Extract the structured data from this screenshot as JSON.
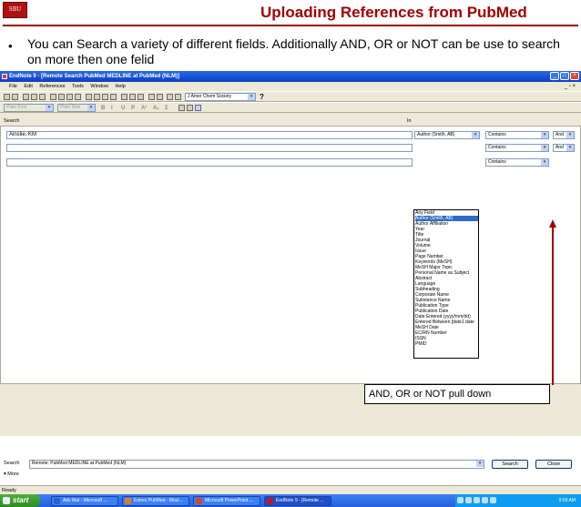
{
  "slide": {
    "logo_text": "SBU",
    "title": "Uploading References from PubMed",
    "bullet_marker": "•",
    "bullet_text": "You can Search a variety of different fields.  Additionally AND, OR or NOT can be use to search on more then one felid"
  },
  "window": {
    "title": "EndNote 9 - [Remote Search PubMed MEDLINE at PubMed (NLM)]",
    "controls": {
      "minimize": "_",
      "restore": "□",
      "close": "×"
    },
    "doc_controls": "_ ▫ ×"
  },
  "menu": [
    "File",
    "Edit",
    "References",
    "Tools",
    "Window",
    "Help"
  ],
  "toolbar": {
    "style_select": "J Amer Chem Society",
    "help": "?",
    "font_select": "Plain Font",
    "size_select": "Plain Size",
    "format_buttons": [
      "B",
      "I",
      "U",
      "P",
      "A¹",
      "A₁",
      "Σ"
    ]
  },
  "search": {
    "label": "Search",
    "in_label": "In",
    "rows": [
      {
        "value": "Ainslie, KM",
        "field": "Author (Smith, AB)",
        "operator": "Contains",
        "boolean": "And"
      },
      {
        "value": "",
        "field": "",
        "operator": "Contains",
        "boolean": "And"
      },
      {
        "value": "",
        "field": "",
        "operator": "Contains",
        "boolean": ""
      }
    ],
    "field_options": [
      "Any Field",
      "Author (Smith, AB)",
      "Author Affiliation",
      "Year",
      "Title",
      "Journal",
      "Volume",
      "Issue",
      "Page Number",
      "Keywords (MeSH)",
      "MeSH Major Topic",
      "Personal Name as Subject",
      "Abstract",
      "Language",
      "Subheading",
      "Corporate Name",
      "Substance Name",
      "Publication Type",
      "Publication Date",
      "Date Entered (yyyy/mm/dd)",
      "Entered Between [date1 date",
      "MeSH Date",
      "EC/RN Number",
      "ISSN",
      "PMID"
    ],
    "selected_option": "Author (Smith, AB)"
  },
  "callout": "AND, OR or NOT pull down",
  "bottom": {
    "search_label": "Search",
    "database": "Remote: PubMed MEDLINE at PubMed (NLM)",
    "search_button": "Search",
    "close_button": "Close",
    "more_label": "▾ More"
  },
  "status": "Ready",
  "taskbar": {
    "start": "start",
    "tasks": [
      {
        "label": "Adv Mat - Microsoft ...",
        "color": "#2f5fcf"
      },
      {
        "label": "Entrez PubMed - Mozi...",
        "color": "#e07b20"
      },
      {
        "label": "Microsoft PowerPoint ...",
        "color": "#d24726"
      },
      {
        "label": "EndNote 9 - [Remote ...",
        "color": "#c01818"
      }
    ],
    "clock": "9:09 AM"
  }
}
